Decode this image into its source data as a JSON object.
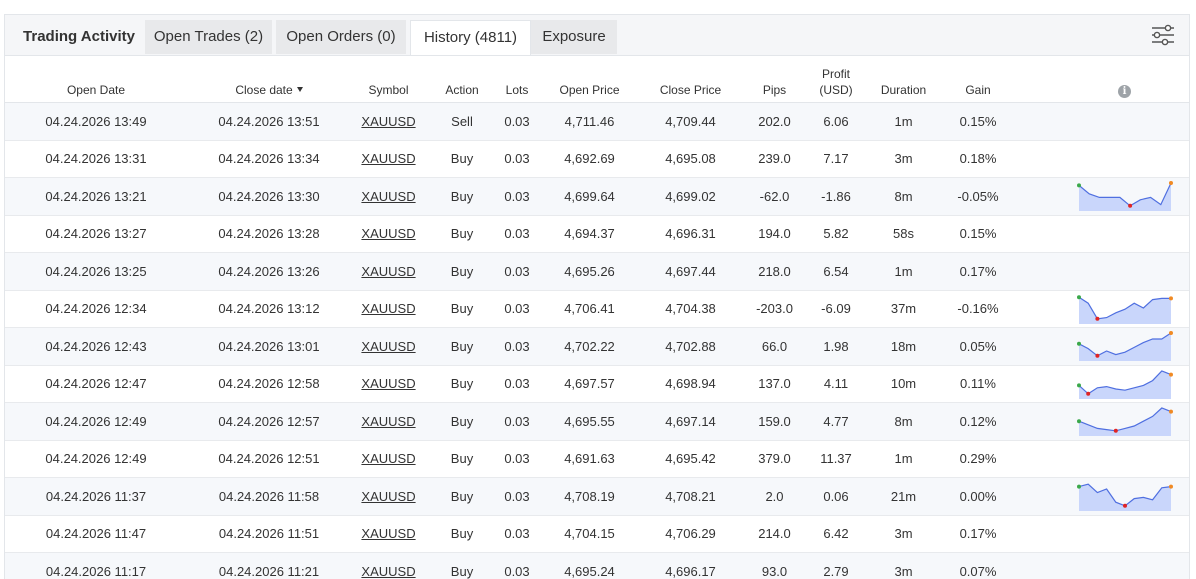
{
  "tabs": [
    {
      "label": "Trading Activity"
    },
    {
      "label": "Open Trades (2)"
    },
    {
      "label": "Open Orders (0)"
    },
    {
      "label": "History (4811)"
    },
    {
      "label": "Exposure"
    }
  ],
  "active_tab": "History (4811)",
  "toolbar": {
    "settings_icon": "sliders-icon"
  },
  "columns": {
    "open_date": "Open Date",
    "close_date": "Close date",
    "symbol": "Symbol",
    "action": "Action",
    "lots": "Lots",
    "open_price": "Open Price",
    "close_price": "Close Price",
    "pips": "Pips",
    "profit_line1": "Profit",
    "profit_line2": "(USD)",
    "duration": "Duration",
    "gain": "Gain",
    "info_icon": "info-icon"
  },
  "colors": {
    "positive": "#1a9b2b",
    "negative": "#e02424",
    "spark_line": "#4f6fe0",
    "spark_fill": "#c9d6fb"
  },
  "rows": [
    {
      "open_date": "04.24.2026 13:49",
      "close_date": "04.24.2026 13:51",
      "symbol": "XAUUSD",
      "action": "Sell",
      "lots": "0.03",
      "open_price": "4,711.46",
      "close_price": "4,709.44",
      "pips": "202.0",
      "profit": "6.06",
      "duration": "1m",
      "gain": "0.15%",
      "spark": null
    },
    {
      "open_date": "04.24.2026 13:31",
      "close_date": "04.24.2026 13:34",
      "symbol": "XAUUSD",
      "action": "Buy",
      "lots": "0.03",
      "open_price": "4,692.69",
      "close_price": "4,695.08",
      "pips": "239.0",
      "profit": "7.17",
      "duration": "3m",
      "gain": "0.18%",
      "spark": null
    },
    {
      "open_date": "04.24.2026 13:21",
      "close_date": "04.24.2026 13:30",
      "symbol": "XAUUSD",
      "action": "Buy",
      "lots": "0.03",
      "open_price": "4,699.64",
      "close_price": "4,699.02",
      "pips": "-62.0",
      "profit": "-1.86",
      "duration": "8m",
      "gain": "-0.05%",
      "spark": [
        0.9,
        0.55,
        0.4,
        0.4,
        0.4,
        0.05,
        0.3,
        0.4,
        0.1,
        1.0
      ]
    },
    {
      "open_date": "04.24.2026 13:27",
      "close_date": "04.24.2026 13:28",
      "symbol": "XAUUSD",
      "action": "Buy",
      "lots": "0.03",
      "open_price": "4,694.37",
      "close_price": "4,696.31",
      "pips": "194.0",
      "profit": "5.82",
      "duration": "58s",
      "gain": "0.15%",
      "spark": null
    },
    {
      "open_date": "04.24.2026 13:25",
      "close_date": "04.24.2026 13:26",
      "symbol": "XAUUSD",
      "action": "Buy",
      "lots": "0.03",
      "open_price": "4,695.26",
      "close_price": "4,697.44",
      "pips": "218.0",
      "profit": "6.54",
      "duration": "1m",
      "gain": "0.17%",
      "spark": null
    },
    {
      "open_date": "04.24.2026 12:34",
      "close_date": "04.24.2026 13:12",
      "symbol": "XAUUSD",
      "action": "Buy",
      "lots": "0.03",
      "open_price": "4,706.41",
      "close_price": "4,704.38",
      "pips": "-203.0",
      "profit": "-6.09",
      "duration": "37m",
      "gain": "-0.16%",
      "spark": [
        0.95,
        0.7,
        0.05,
        0.1,
        0.3,
        0.45,
        0.7,
        0.5,
        0.85,
        0.9,
        0.9
      ]
    },
    {
      "open_date": "04.24.2026 12:43",
      "close_date": "04.24.2026 13:01",
      "symbol": "XAUUSD",
      "action": "Buy",
      "lots": "0.03",
      "open_price": "4,702.22",
      "close_price": "4,702.88",
      "pips": "66.0",
      "profit": "1.98",
      "duration": "18m",
      "gain": "0.05%",
      "spark": [
        0.55,
        0.35,
        0.05,
        0.25,
        0.1,
        0.2,
        0.4,
        0.6,
        0.75,
        0.75,
        1.0
      ]
    },
    {
      "open_date": "04.24.2026 12:47",
      "close_date": "04.24.2026 12:58",
      "symbol": "XAUUSD",
      "action": "Buy",
      "lots": "0.03",
      "open_price": "4,697.57",
      "close_price": "4,698.94",
      "pips": "137.0",
      "profit": "4.11",
      "duration": "10m",
      "gain": "0.11%",
      "spark": [
        0.4,
        0.05,
        0.3,
        0.35,
        0.25,
        0.2,
        0.3,
        0.4,
        0.6,
        1.0,
        0.85
      ]
    },
    {
      "open_date": "04.24.2026 12:49",
      "close_date": "04.24.2026 12:57",
      "symbol": "XAUUSD",
      "action": "Buy",
      "lots": "0.03",
      "open_price": "4,695.55",
      "close_price": "4,697.14",
      "pips": "159.0",
      "profit": "4.77",
      "duration": "8m",
      "gain": "0.12%",
      "spark": [
        0.45,
        0.3,
        0.15,
        0.1,
        0.05,
        0.15,
        0.25,
        0.45,
        0.65,
        1.0,
        0.85
      ]
    },
    {
      "open_date": "04.24.2026 12:49",
      "close_date": "04.24.2026 12:51",
      "symbol": "XAUUSD",
      "action": "Buy",
      "lots": "0.03",
      "open_price": "4,691.63",
      "close_price": "4,695.42",
      "pips": "379.0",
      "profit": "11.37",
      "duration": "1m",
      "gain": "0.29%",
      "spark": null
    },
    {
      "open_date": "04.24.2026 11:37",
      "close_date": "04.24.2026 11:58",
      "symbol": "XAUUSD",
      "action": "Buy",
      "lots": "0.03",
      "open_price": "4,708.19",
      "close_price": "4,708.21",
      "pips": "2.0",
      "profit": "0.06",
      "duration": "21m",
      "gain": "0.00%",
      "spark": [
        0.85,
        0.95,
        0.6,
        0.75,
        0.2,
        0.05,
        0.35,
        0.4,
        0.3,
        0.8,
        0.85
      ]
    },
    {
      "open_date": "04.24.2026 11:47",
      "close_date": "04.24.2026 11:51",
      "symbol": "XAUUSD",
      "action": "Buy",
      "lots": "0.03",
      "open_price": "4,704.15",
      "close_price": "4,706.29",
      "pips": "214.0",
      "profit": "6.42",
      "duration": "3m",
      "gain": "0.17%",
      "spark": null
    },
    {
      "open_date": "04.24.2026 11:17",
      "close_date": "04.24.2026 11:21",
      "symbol": "XAUUSD",
      "action": "Buy",
      "lots": "0.03",
      "open_price": "4,695.24",
      "close_price": "4,696.17",
      "pips": "93.0",
      "profit": "2.79",
      "duration": "3m",
      "gain": "0.07%",
      "spark": null
    }
  ]
}
